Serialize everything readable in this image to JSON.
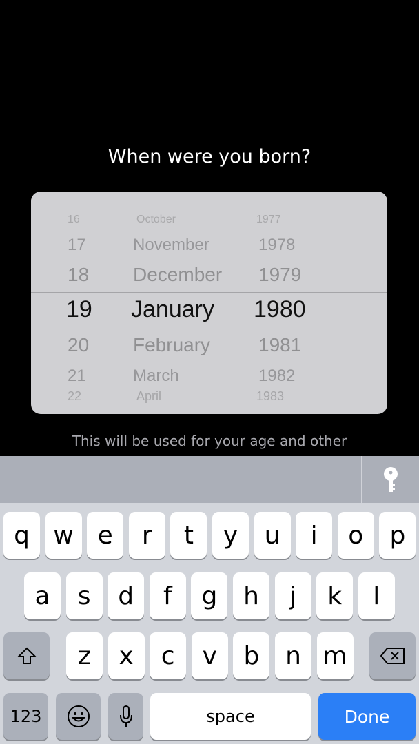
{
  "title": "When were you born?",
  "picker": {
    "days": [
      "16",
      "17",
      "18",
      "19",
      "20",
      "21",
      "22"
    ],
    "months": [
      "October",
      "November",
      "December",
      "January",
      "February",
      "March",
      "April"
    ],
    "years": [
      "1977",
      "1978",
      "1979",
      "1980",
      "1981",
      "1982",
      "1983"
    ],
    "selected": {
      "day": "19",
      "month": "January",
      "year": "1980"
    }
  },
  "helper_text": "This will be used for your age and other",
  "accessory": {
    "icon": "key-icon"
  },
  "keyboard": {
    "row1": [
      "q",
      "w",
      "e",
      "r",
      "t",
      "y",
      "u",
      "i",
      "o",
      "p"
    ],
    "row2": [
      "a",
      "s",
      "d",
      "f",
      "g",
      "h",
      "j",
      "k",
      "l"
    ],
    "row3": [
      "z",
      "x",
      "c",
      "v",
      "b",
      "n",
      "m"
    ],
    "numbers_label": "123",
    "space_label": "space",
    "done_label": "Done",
    "accent": "#2b7ff6"
  }
}
